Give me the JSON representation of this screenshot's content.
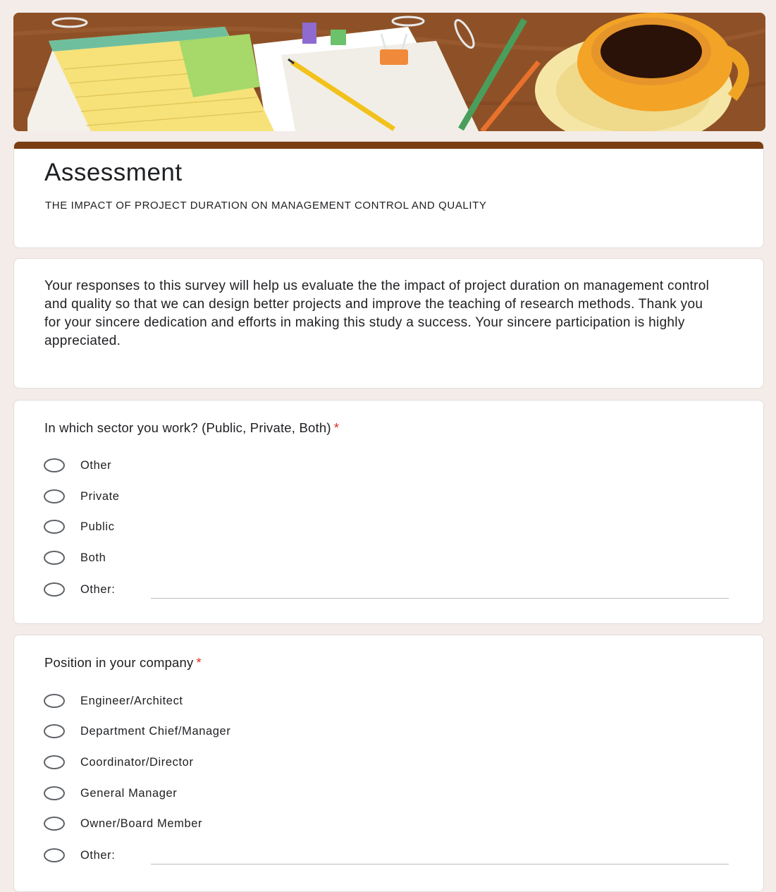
{
  "form": {
    "title": "Assessment",
    "subtitle": "THE IMPACT OF PROJECT DURATION ON MANAGEMENT CONTROL AND QUALITY",
    "description": "Your responses to this survey will help us evaluate the the impact of project duration on management control and quality so that we can design better projects and improve the teaching of research methods. Thank you for your sincere dedication and efforts in making this study a success. Your sincere participation is highly appreciated."
  },
  "questions": [
    {
      "title": "In which sector you work? (Public, Private, Both)",
      "required_mark": "*",
      "options": [
        "Other",
        "Private",
        "Public",
        "Both"
      ],
      "other_label": "Other:"
    },
    {
      "title": "Position in your company",
      "required_mark": "*",
      "options": [
        "Engineer/Architect",
        "Department Chief/Manager",
        "Coordinator/Director",
        "General Manager",
        "Owner/Board Member"
      ],
      "other_label": "Other:"
    }
  ],
  "colors": {
    "accent": "#7a3e12",
    "required": "#d93025",
    "background": "#f4ece8"
  }
}
